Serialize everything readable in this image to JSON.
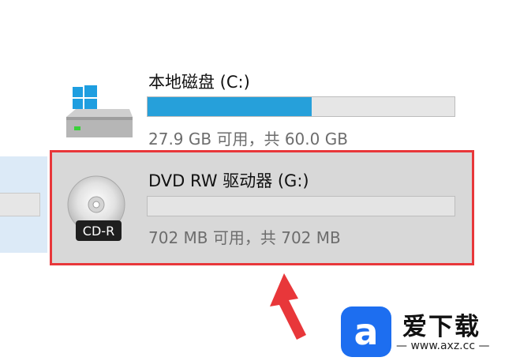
{
  "drives": {
    "c": {
      "name": "本地磁盘 (C:)",
      "space": "27.9 GB 可用，共 60.0 GB",
      "used_fraction": 0.535,
      "icon": "windows-hard-drive-icon"
    },
    "g": {
      "name": "DVD RW 驱动器 (G:)",
      "space": "702 MB 可用，共 702 MB",
      "used_fraction": 0,
      "disc_label": "CD-R",
      "icon": "cd-r-disc-icon"
    }
  },
  "colors": {
    "usage_fill": "#26a0da",
    "highlight": "#e8373a",
    "watermark_logo": "#1d6ef0"
  },
  "watermark": {
    "title": "爱下载",
    "url": "— www.axz.cc —",
    "logo_glyph": "a"
  }
}
